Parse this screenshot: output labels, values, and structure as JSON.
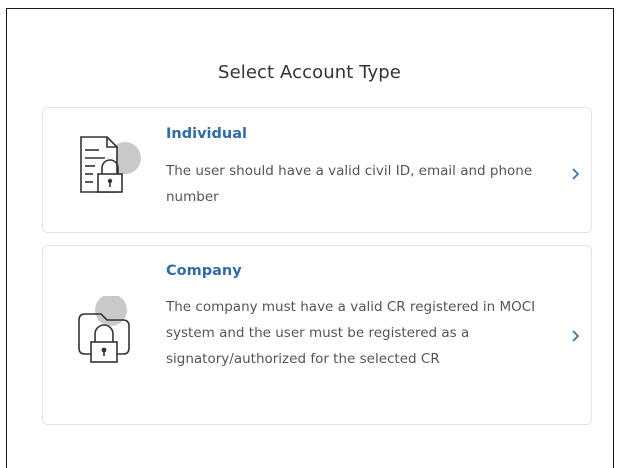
{
  "page": {
    "title": "Select Account Type"
  },
  "options": [
    {
      "label": "Individual",
      "description": "The user should have a valid civil ID, email and phone number",
      "icon": "document-lock-icon"
    },
    {
      "label": "Company",
      "description": "The company must have a valid CR registered in MOCI system and the user must be registered as a signatory/authorized for the selected CR",
      "icon": "folder-lock-icon"
    }
  ],
  "colors": {
    "accent": "#2f6da6",
    "text": "#555555",
    "border": "#e3e3e3"
  }
}
